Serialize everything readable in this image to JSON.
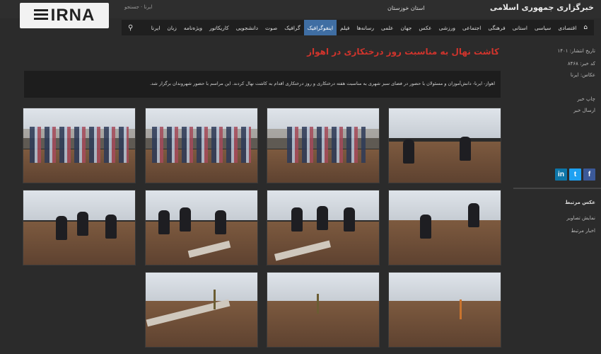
{
  "header": {
    "logo_text": "IRNA",
    "top_small": "ایرنا · جستجو",
    "region": "استان خوزستان",
    "site_title": "خبرگزاری جمهوری اسلامی"
  },
  "nav": {
    "home_icon": "home-icon",
    "search_icon": "search-icon",
    "items": [
      "اقتصادی",
      "سیاسی",
      "استانی",
      "فرهنگی",
      "اجتماعی",
      "ورزشی",
      "عکس",
      "جهان",
      "علمی",
      "رسانه‌ها",
      "فیلم",
      "اینفوگرافیک",
      "گرافیک",
      "صوت",
      "دانشجویی",
      "کاریکاتور",
      "ویژه‌نامه",
      "زبان",
      "ایرنا"
    ],
    "active_index": 4
  },
  "sidebar": {
    "links": [
      "تاریخ انتشار: ۱۴۰۱",
      "کد خبر: ۸۴۶۸",
      "عکاس: ایرنا",
      "چاپ خبر",
      "ارسال خبر"
    ],
    "section_title": "عکس مرتبط",
    "section_links": [
      "نمایش تصاویر",
      "اخبار مرتبط"
    ],
    "social": [
      {
        "icon": "facebook-icon",
        "glyph": "f",
        "color": "#3b5998"
      },
      {
        "icon": "twitter-icon",
        "glyph": "t",
        "color": "#1da1f2"
      },
      {
        "icon": "linkedin-icon",
        "glyph": "in",
        "color": "#0e76a8"
      }
    ]
  },
  "article": {
    "headline": "کاشت نهال به مناسبت روز درختکاری در اهواز",
    "caption": "اهواز- ایرنا- دانش‌آموزان و مسئولان با حضور در فضای سبز شهری به مناسبت هفته درختکاری و روز درختکاری اقدام به کاشت نهال کردند. این مراسم با حضور شهروندان برگزار شد."
  },
  "gallery": {
    "photos": [
      {
        "label": "photo-1"
      },
      {
        "label": "photo-2"
      },
      {
        "label": "photo-3"
      },
      {
        "label": "photo-4"
      },
      {
        "label": "photo-5"
      },
      {
        "label": "photo-6"
      },
      {
        "label": "photo-7"
      },
      {
        "label": "photo-8"
      },
      {
        "label": "photo-9"
      },
      {
        "label": "photo-10"
      },
      {
        "label": "photo-11"
      }
    ]
  }
}
